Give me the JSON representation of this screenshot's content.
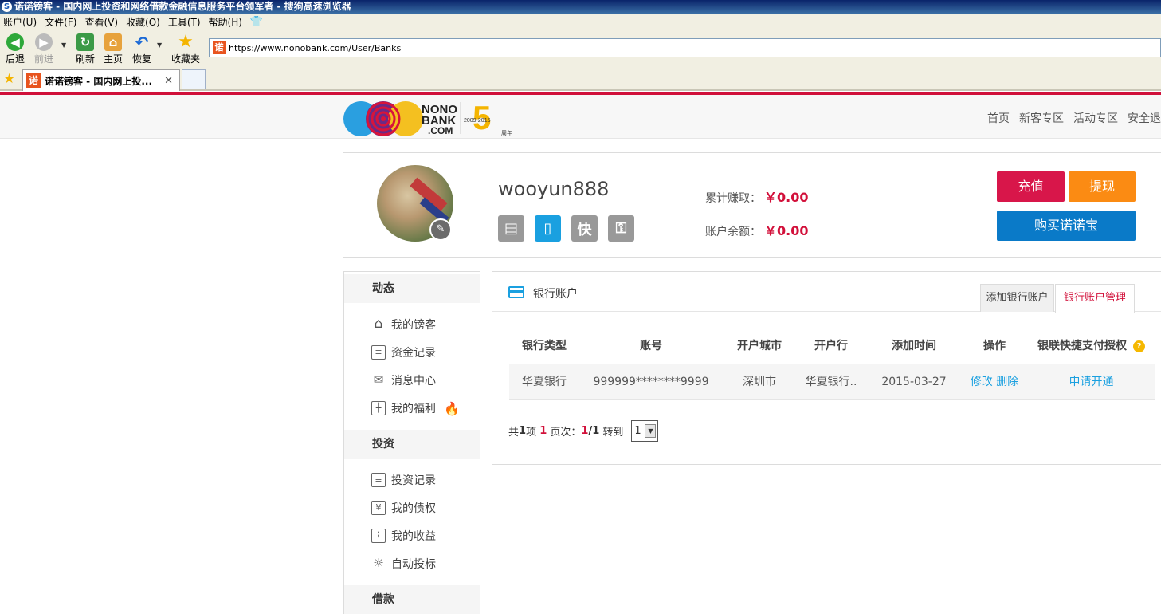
{
  "browser": {
    "title": "诺诺镑客 - 国内网上投资和网络借款金融信息服务平台领军者 - 搜狗高速浏览器",
    "menu": [
      "账户(U)",
      "文件(F)",
      "查看(V)",
      "收藏(O)",
      "工具(T)",
      "帮助(H)"
    ],
    "toolbar": {
      "back": "后退",
      "forward": "前进",
      "refresh": "刷新",
      "home": "主页",
      "restore": "恢复",
      "favorites": "收藏夹"
    },
    "url": "https://www.nonobank.com/User/Banks",
    "tab_title": "诺诺镑客 - 国内网上投..."
  },
  "site": {
    "logo_text": [
      "NONO",
      "BANK",
      ".COM"
    ],
    "anniversary": {
      "years": "2009-2015",
      "number": "5",
      "suffix": "周年"
    },
    "nav": [
      "首页",
      "新客专区",
      "活动专区",
      "安全退"
    ]
  },
  "profile": {
    "username": "wooyun888",
    "verify_icons": [
      "id-card-icon",
      "phone-icon",
      "quick-pay-icon",
      "key-icon"
    ],
    "quick_label": "快",
    "earned_label": "累计赚取：",
    "earned_value": "￥0.00",
    "balance_label": "账户余额：",
    "balance_value": "￥0.00",
    "recharge": "充值",
    "withdraw": "提现",
    "buy": "购买诺诺宝"
  },
  "sidebar": {
    "sections": [
      {
        "title": "动态",
        "items": [
          "我的镑客",
          "资金记录",
          "消息中心",
          "我的福利"
        ]
      },
      {
        "title": "投资",
        "items": [
          "投资记录",
          "我的债权",
          "我的收益",
          "自动投标"
        ]
      },
      {
        "title": "借款",
        "items": []
      }
    ]
  },
  "bank": {
    "title": "银行账户",
    "tabs": {
      "add": "添加银行账户",
      "manage": "银行账户管理"
    },
    "columns": [
      "银行类型",
      "账号",
      "开户城市",
      "开户行",
      "添加时间",
      "操作",
      "银联快捷支付授权"
    ],
    "rows": [
      {
        "bank": "华夏银行",
        "account": "999999********9999",
        "city": "深圳市",
        "branch": "华夏银行..",
        "date": "2015-03-27",
        "edit": "修改",
        "delete": "删除",
        "authorize": "申请开通"
      }
    ],
    "pager": {
      "prefix": "共",
      "total": "1",
      "unit": "项",
      "current": "1",
      "pages_label": "页次：",
      "slash": "/",
      "total_pages": "1",
      "goto": "转到",
      "select_value": "1"
    }
  }
}
